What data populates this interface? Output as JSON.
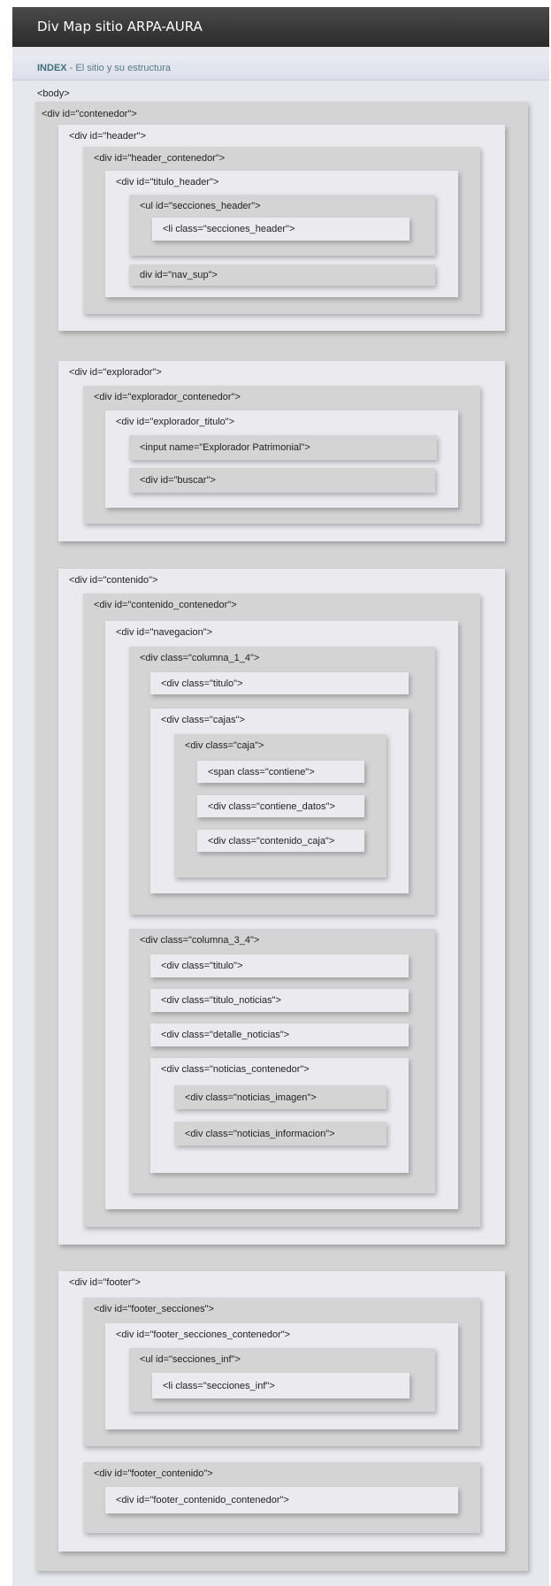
{
  "header": {
    "title": "Div Map sitio ARPA-AURA"
  },
  "breadcrumb": {
    "key": "INDEX",
    "separator": " - ",
    "text": "El sitio y su estructura"
  },
  "tags": {
    "body": "<body>",
    "contenedor": "<div id=\"contenedor\">",
    "header": "<div id=\"header\">",
    "header_contenedor": "<div id=\"header_contenedor\">",
    "titulo_header": "<div id=\"titulo_header\">",
    "ul_secciones_header": "<ul id=\"secciones_header\">",
    "li_secciones_header": "<li class=\"secciones_header\">",
    "nav_sup": "div id=\"nav_sup\">",
    "explorador": "<div id=\"explorador\">",
    "explorador_contenedor": "<div id=\"explorador_contenedor\">",
    "explorador_titulo": "<div id=\"explorador_titulo\">",
    "input_explorador": "<input name=\"Explorador Patrimonial\">",
    "buscar": "<div id=\"buscar\">",
    "contenido": "<div id=\"contenido\">",
    "contenido_contenedor": "<div id=\"contenido_contenedor\">",
    "navegacion": "<div id=\"navegacion\">",
    "columna_1_4": "<div class=\"columna_1_4\">",
    "titulo_1": "<div class=\"titulo\">",
    "cajas": "<div class=\"cajas\">",
    "caja": "<div class=\"caja\">",
    "span_contiene": "<span class=\"contiene\">",
    "contiene_datos": "<div class=\"contiene_datos\">",
    "contenido_caja": "<div class=\"contenido_caja\">",
    "columna_3_4": "<div class=\"columna_3_4\">",
    "titulo_2": "<div class=\"titulo\">",
    "titulo_noticias": "<div class=\"titulo_noticias\">",
    "detalle_noticias": "<div class=\"detalle_noticias\">",
    "noticias_contenedor": "<div class=\"noticias_contenedor\">",
    "noticias_imagen": "<div class=\"noticias_imagen\">",
    "noticias_informacion": "<div class=\"noticias_informacion\">",
    "footer": "<div id=\"footer\">",
    "footer_secciones": "<div id=\"footer_secciones\">",
    "footer_secciones_contenedor": "<div id=\"footer_secciones_contenedor\">",
    "ul_secciones_inf": "<ul id=\"secciones_inf\">",
    "li_secciones_inf": "<li class=\"secciones_inf\">",
    "footer_contenido": "<div id=\"footer_contenido\">",
    "footer_contenido_contenedor": "<div id=\"footer_contenido_contenedor\">"
  }
}
